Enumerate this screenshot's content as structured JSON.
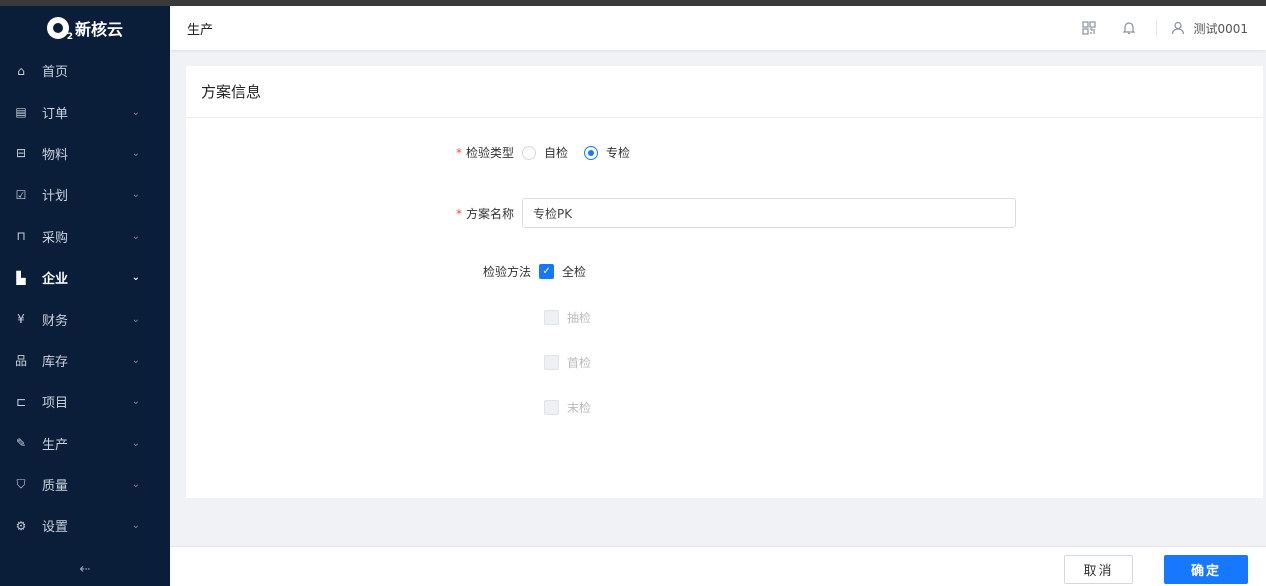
{
  "app": {
    "logo_text": "新核云",
    "logo_sub": "2"
  },
  "sidebar": {
    "items": [
      {
        "label": "首页",
        "icon": "⌂",
        "arrow": ""
      },
      {
        "label": "订单",
        "icon": "▤",
        "arrow": "⌄"
      },
      {
        "label": "物料",
        "icon": "⊟",
        "arrow": "⌄"
      },
      {
        "label": "计划",
        "icon": "☑",
        "arrow": "⌄"
      },
      {
        "label": "采购",
        "icon": "⊓",
        "arrow": "⌄"
      },
      {
        "label": "企业",
        "icon": "▙",
        "arrow": "⌄"
      },
      {
        "label": "财务",
        "icon": "¥",
        "arrow": "⌄"
      },
      {
        "label": "库存",
        "icon": "品",
        "arrow": "⌄"
      },
      {
        "label": "项目",
        "icon": "⊏",
        "arrow": "⌄"
      },
      {
        "label": "生产",
        "icon": "✎",
        "arrow": "⌄"
      },
      {
        "label": "质量",
        "icon": "⛉",
        "arrow": "⌄"
      },
      {
        "label": "设置",
        "icon": "⚙",
        "arrow": "⌄"
      }
    ],
    "active_index": 5,
    "collapse_icon": "⇠"
  },
  "header": {
    "title": "生产",
    "qr_icon": "qr-code-icon",
    "bell_icon": "bell-icon",
    "user_icon": "user-icon",
    "username": "测试0001"
  },
  "card": {
    "title": "方案信息",
    "inspection_type": {
      "label": "检验类型",
      "required": "*",
      "options": [
        "自检",
        "专检"
      ],
      "selected": "专检"
    },
    "plan_name": {
      "label": "方案名称",
      "required": "*",
      "value": "专检PK"
    },
    "inspection_method": {
      "label": "检验方法",
      "options": [
        {
          "label": "全检",
          "checked": true,
          "disabled": false
        },
        {
          "label": "抽检",
          "checked": false,
          "disabled": true
        },
        {
          "label": "首检",
          "checked": false,
          "disabled": true
        },
        {
          "label": "末检",
          "checked": false,
          "disabled": true
        }
      ]
    }
  },
  "footer": {
    "cancel_label": "取消",
    "ok_label": "确定"
  },
  "colors": {
    "sidebar_bg": "#0b1e39",
    "primary": "#1677ff",
    "required": "#e94b4b"
  }
}
